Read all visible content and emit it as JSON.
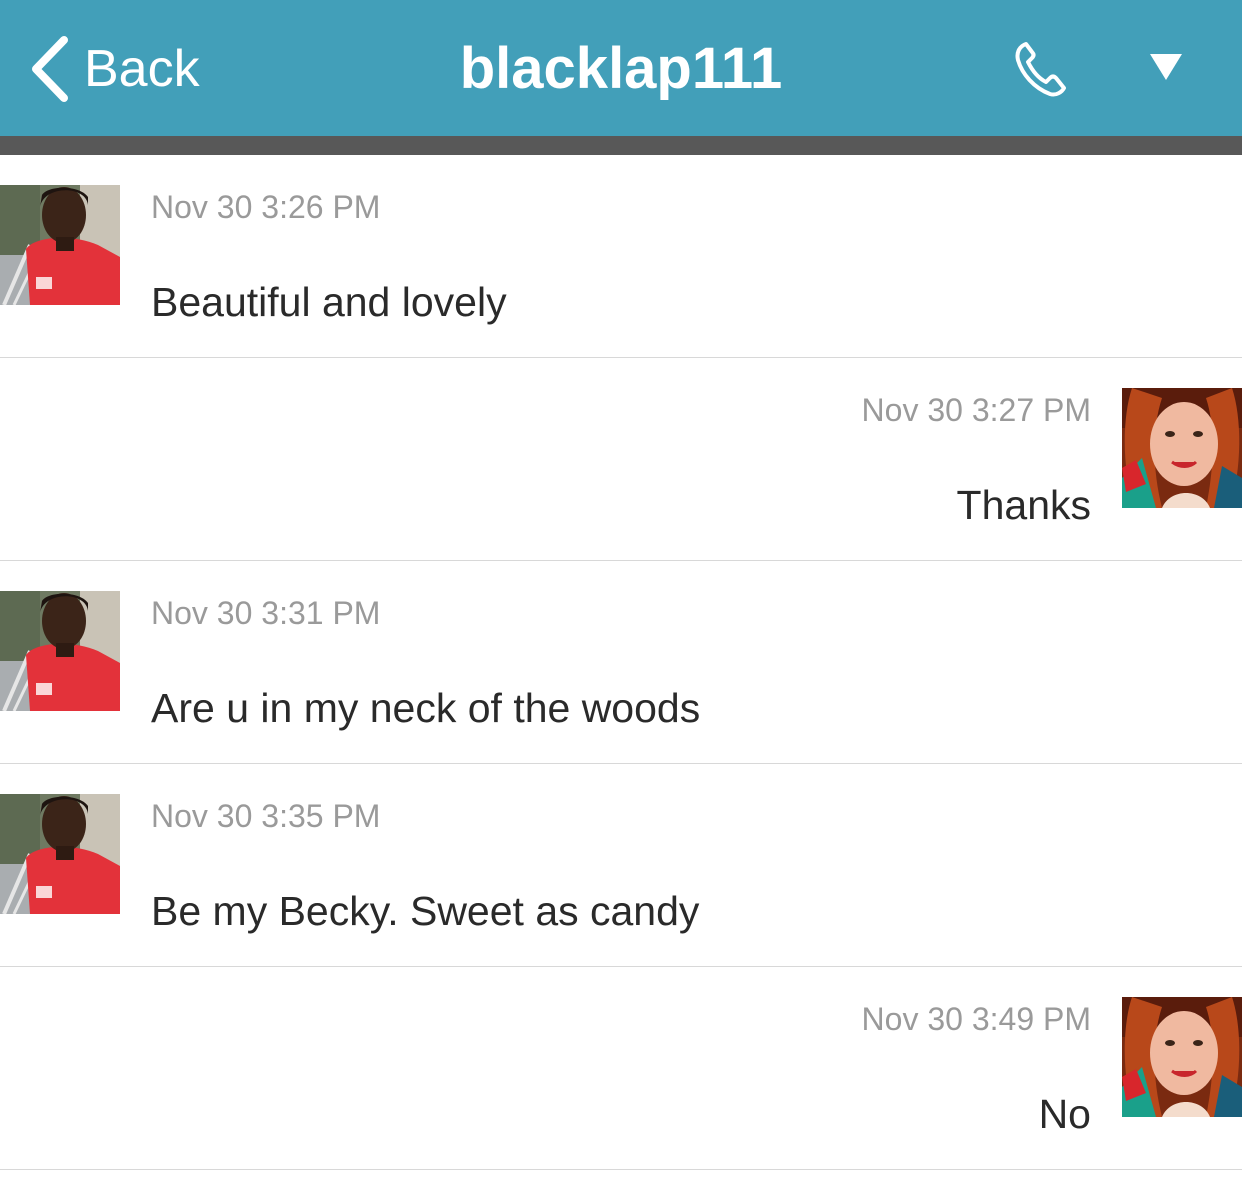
{
  "header": {
    "back_label": "Back",
    "title": "blacklap111",
    "call_icon": "phone-icon",
    "menu_icon": "triangle-down-icon",
    "bg_color": "#429fb9"
  },
  "messages": [
    {
      "sender": "contact",
      "timestamp": "Nov 30 3:26 PM",
      "text": "Beautiful and lovely"
    },
    {
      "sender": "me",
      "timestamp": "Nov 30 3:27 PM",
      "text": "Thanks"
    },
    {
      "sender": "contact",
      "timestamp": "Nov 30 3:31 PM",
      "text": "Are u in my neck of the woods"
    },
    {
      "sender": "contact",
      "timestamp": "Nov 30 3:35 PM",
      "text": "Be my Becky. Sweet as candy"
    },
    {
      "sender": "me",
      "timestamp": "Nov 30 3:49 PM",
      "text": "No"
    }
  ]
}
